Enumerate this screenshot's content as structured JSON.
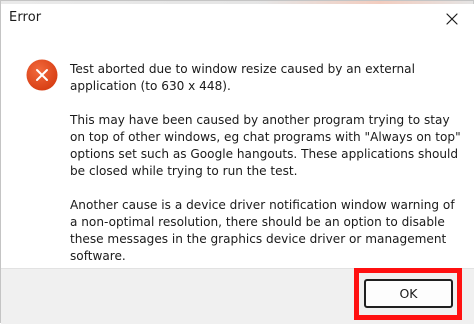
{
  "window": {
    "title": "Error",
    "close_icon": "close-icon"
  },
  "dialog": {
    "icon": "error-icon",
    "icon_color": "#e04a1b",
    "paragraphs": [
      "Test aborted due to window resize caused by an external application (to 630 x 448).",
      "This may have been caused by another program trying to stay on top of other windows, eg chat programs with \"Always on top\" options set such as Google hangouts. These applications should be closed while trying to run the test.",
      "Another cause is a device driver notification window warning of a non-optimal resolution, there should be an option to disable these messages in the graphics device driver or management software."
    ]
  },
  "buttons": {
    "ok_label": "OK"
  },
  "highlight_color": "#ff1010"
}
